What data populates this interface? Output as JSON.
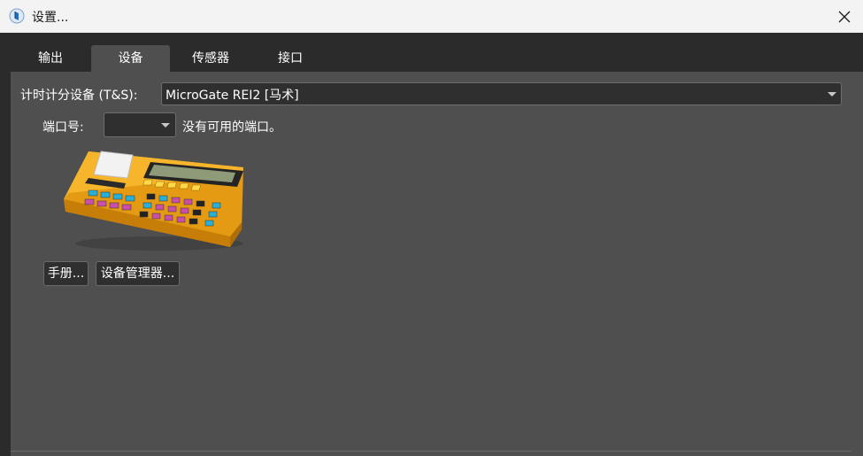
{
  "window": {
    "title": "设置..."
  },
  "tabs": [
    {
      "label": "输出"
    },
    {
      "label": "设备"
    },
    {
      "label": "传感器"
    },
    {
      "label": "接口"
    }
  ],
  "active_tab": "设备",
  "timing_device": {
    "label": "计时计分设备 (T&S):",
    "value": "MicroGate REI2 [马术]"
  },
  "port": {
    "label": "端口号:",
    "value": "",
    "status": "没有可用的端口。"
  },
  "buttons": {
    "manual": "手册...",
    "device_manager": "设备管理器..."
  },
  "colors": {
    "panel_bg": "#4f4f4f",
    "window_bg": "#2b2b2b",
    "titlebar_bg": "#f3f3f3",
    "device_body": "#f2a91c"
  }
}
